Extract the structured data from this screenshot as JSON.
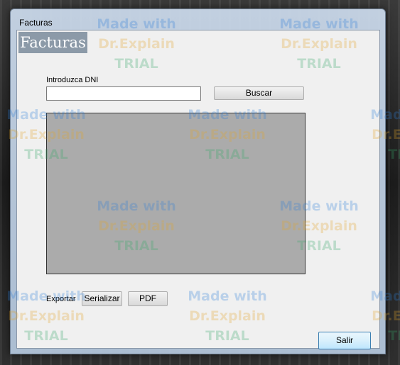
{
  "window": {
    "title": "Facturas",
    "header_logo": "Facturas"
  },
  "search": {
    "label": "Introduzca DNI",
    "value": "",
    "button_label": "Buscar"
  },
  "export": {
    "label": "Exportar",
    "serialize_label": "Serializar",
    "pdf_label": "PDF"
  },
  "footer": {
    "exit_label": "Salir"
  },
  "watermark": {
    "line1": "Made with",
    "line2": "Dr.Explain",
    "line3": "TRIAL"
  }
}
